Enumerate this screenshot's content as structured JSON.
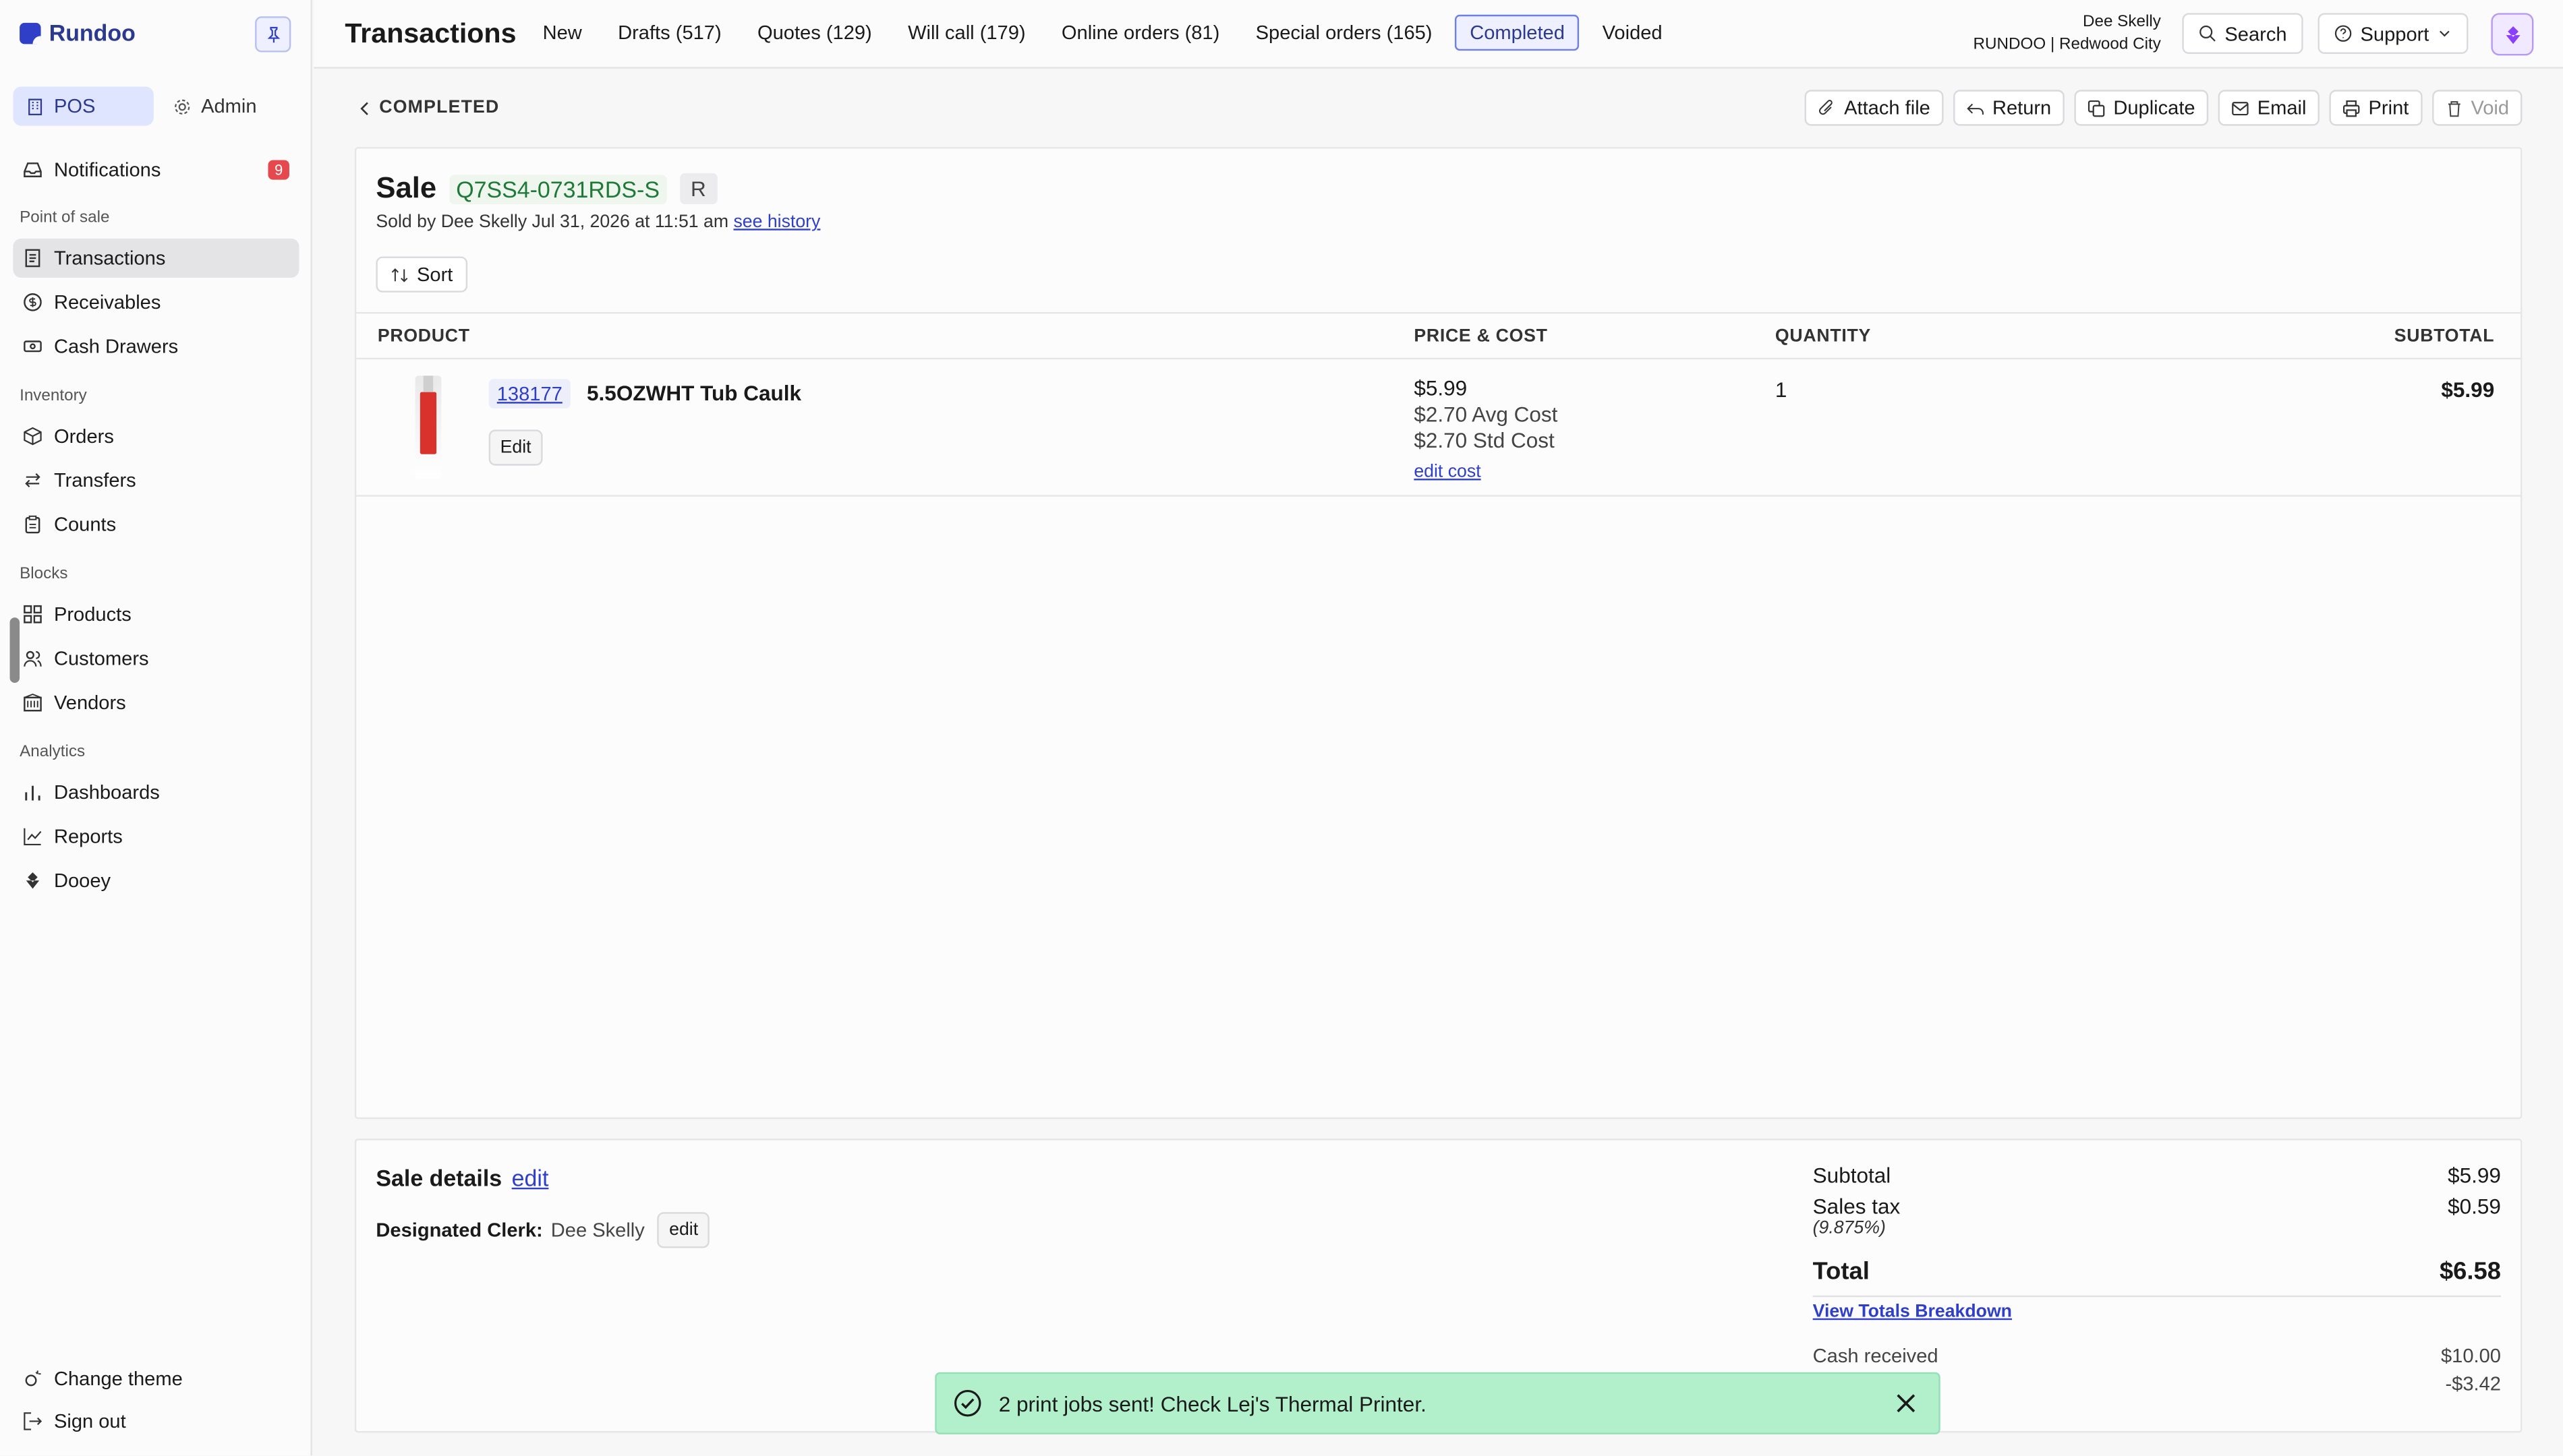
{
  "app": {
    "name": "Rundoo"
  },
  "sidebar": {
    "modes": [
      {
        "label": "POS",
        "icon": "building-icon"
      },
      {
        "label": "Admin",
        "icon": "gear-icon"
      }
    ],
    "notifications": {
      "label": "Notifications",
      "count": "9"
    },
    "sections": {
      "pos": "Point of sale",
      "inventory": "Inventory",
      "blocks": "Blocks",
      "analytics": "Analytics"
    },
    "items": {
      "transactions": "Transactions",
      "receivables": "Receivables",
      "cash_drawers": "Cash Drawers",
      "orders": "Orders",
      "transfers": "Transfers",
      "counts": "Counts",
      "products": "Products",
      "customers": "Customers",
      "vendors": "Vendors",
      "dashboards": "Dashboards",
      "reports": "Reports",
      "dooey": "Dooey"
    },
    "footer": {
      "change_theme": "Change theme",
      "sign_out": "Sign out"
    }
  },
  "header": {
    "title": "Transactions",
    "tabs": [
      "New",
      "Drafts (517)",
      "Quotes (129)",
      "Will call (179)",
      "Online orders (81)",
      "Special orders (165)",
      "Completed",
      "Voided"
    ],
    "active_tab": "Completed",
    "user": {
      "name": "Dee Skelly",
      "store": "RUNDOO | Redwood City"
    },
    "search_label": "Search",
    "support_label": "Support"
  },
  "toolbar": {
    "back_label": "COMPLETED",
    "attach": "Attach file",
    "return": "Return",
    "duplicate": "Duplicate",
    "email": "Email",
    "print": "Print",
    "void": "Void"
  },
  "sale": {
    "label": "Sale",
    "id": "Q7SS4-0731RDS-S",
    "tag": "R",
    "sold_by": "Sold by Dee Skelly Jul 31, 2026 at 11:51 am",
    "history_link": "see history",
    "sort_label": "Sort"
  },
  "table": {
    "headers": {
      "product": "PRODUCT",
      "price": "PRICE & COST",
      "quantity": "QUANTITY",
      "subtotal": "SUBTOTAL"
    },
    "rows": [
      {
        "sku": "138177",
        "name": "5.5OZWHT Tub Caulk",
        "edit": "Edit",
        "price": "$5.99",
        "avg_cost": "$2.70 Avg Cost",
        "std_cost": "$2.70 Std Cost",
        "edit_cost": "edit cost",
        "quantity": "1",
        "subtotal": "$5.99"
      }
    ]
  },
  "details": {
    "title": "Sale details",
    "edit_link": "edit",
    "clerk_label": "Designated Clerk:",
    "clerk_name": "Dee Skelly",
    "clerk_edit": "edit"
  },
  "totals": {
    "subtotal_label": "Subtotal",
    "subtotal": "$5.99",
    "tax_label": "Sales tax",
    "tax_rate": "(9.875%)",
    "tax": "$0.59",
    "total_label": "Total",
    "total": "$6.58",
    "breakdown_link": "View Totals Breakdown",
    "cash_label": "Cash received",
    "cash": "$10.00",
    "change": "-$3.42"
  },
  "toast": {
    "message": "2 print jobs sent! Check Lej's Thermal Printer."
  },
  "colors": {
    "accent": "#2f3fc8",
    "sale_id": "#1f7a3a",
    "toast_bg": "#b2f0cc",
    "badge": "#e5484d"
  }
}
